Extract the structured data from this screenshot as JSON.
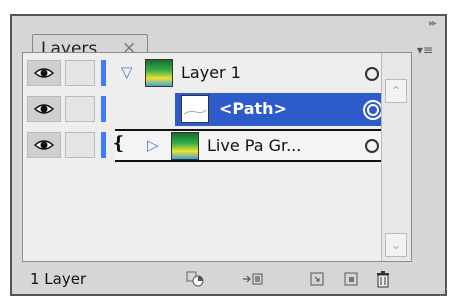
{
  "panel": {
    "collapse_glyph": "▸▸",
    "tab_label": "Layers",
    "tab_close": "×",
    "menu_glyph": "▾≡"
  },
  "layers": [
    {
      "label": "Layer 1",
      "expanded": true
    },
    {
      "label": "<Path>",
      "selected": true
    },
    {
      "label": "Live Pa  Gr...",
      "expanded": false
    }
  ],
  "footer": {
    "count_label": "1 Layer"
  },
  "colors": {
    "accent": "#3f7bff",
    "selection": "#2d5bc9",
    "panel_bg": "#d6d6d6",
    "list_bg": "#eeeeee"
  }
}
